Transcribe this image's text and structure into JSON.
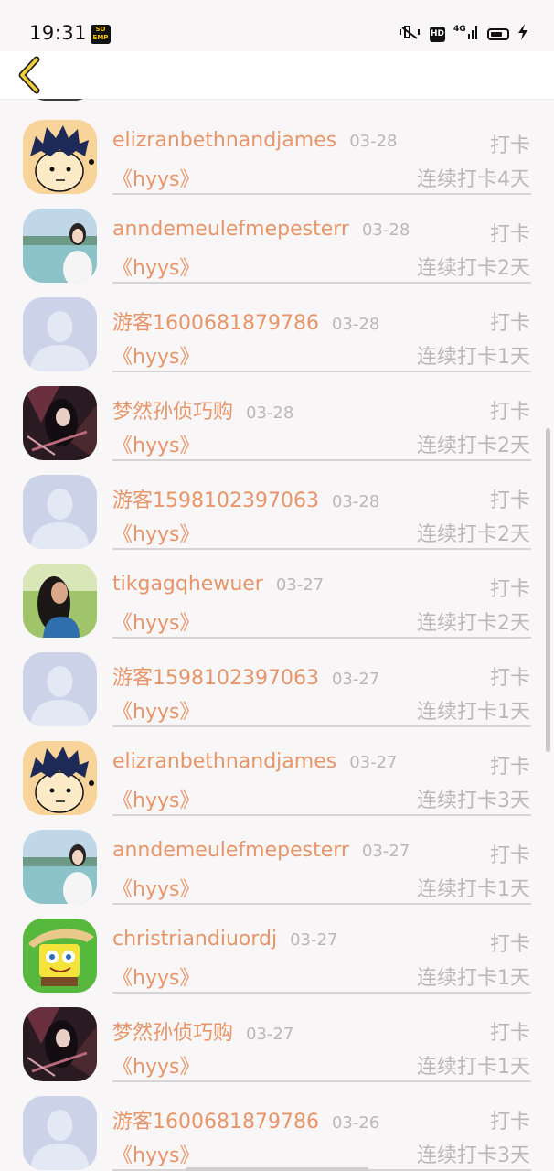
{
  "status_bar": {
    "time": "19:31",
    "badge_text": "SO\nEMP",
    "hd_label": "HD",
    "signal_label": "4G"
  },
  "header": {
    "back_icon": "chevron-left-icon",
    "accent_color": "#f2cf3b"
  },
  "colors": {
    "username": "#e8956a",
    "muted": "#b9b7b8",
    "background": "#f8f6f7"
  },
  "rows": [
    {
      "avatar": "cartoon-boy",
      "username": "elizranbethnandjames",
      "date": "03-28",
      "action": "打卡",
      "title": "《hyys》",
      "streak": "连续打卡4天"
    },
    {
      "avatar": "photo-girl-lake",
      "username": "anndemeulefmepesterr",
      "date": "03-28",
      "action": "打卡",
      "title": "《hyys》",
      "streak": "连续打卡2天"
    },
    {
      "avatar": "default-user",
      "username": "游客1600681879786",
      "date": "03-28",
      "action": "打卡",
      "title": "《hyys》",
      "streak": "连续打卡1天"
    },
    {
      "avatar": "anime-dark",
      "username": "梦然孙侦巧购",
      "date": "03-28",
      "action": "打卡",
      "title": "《hyys》",
      "streak": "连续打卡2天"
    },
    {
      "avatar": "default-user",
      "username": "游客1598102397063",
      "date": "03-28",
      "action": "打卡",
      "title": "《hyys》",
      "streak": "连续打卡2天"
    },
    {
      "avatar": "photo-woman-outdoor",
      "username": "tikgagqhewuer",
      "date": "03-27",
      "action": "打卡",
      "title": "《hyys》",
      "streak": "连续打卡2天"
    },
    {
      "avatar": "default-user",
      "username": "游客1598102397063",
      "date": "03-27",
      "action": "打卡",
      "title": "《hyys》",
      "streak": "连续打卡1天"
    },
    {
      "avatar": "cartoon-boy",
      "username": "elizranbethnandjames",
      "date": "03-27",
      "action": "打卡",
      "title": "《hyys》",
      "streak": "连续打卡3天"
    },
    {
      "avatar": "photo-girl-lake",
      "username": "anndemeulefmepesterr",
      "date": "03-27",
      "action": "打卡",
      "title": "《hyys》",
      "streak": "连续打卡1天"
    },
    {
      "avatar": "spongebob",
      "username": "christriandiuordj",
      "date": "03-27",
      "action": "打卡",
      "title": "《hyys》",
      "streak": "连续打卡1天"
    },
    {
      "avatar": "anime-dark",
      "username": "梦然孙侦巧购",
      "date": "03-27",
      "action": "打卡",
      "title": "《hyys》",
      "streak": "连续打卡1天"
    },
    {
      "avatar": "default-user",
      "username": "游客1600681879786",
      "date": "03-26",
      "action": "打卡",
      "title": "《hyys》",
      "streak": "连续打卡3天"
    }
  ]
}
